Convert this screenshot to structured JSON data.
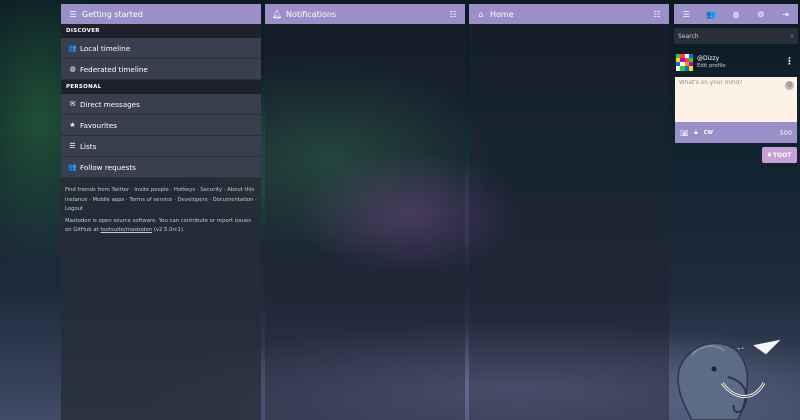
{
  "getting_started": {
    "title": "Getting started",
    "discover_label": "DISCOVER",
    "local_timeline": "Local timeline",
    "federated_timeline": "Federated timeline",
    "personal_label": "PERSONAL",
    "direct_messages": "Direct messages",
    "favourites": "Favourites",
    "lists": "Lists",
    "follow_requests": "Follow requests",
    "footer": {
      "find_friends": "Find friends from Twitter",
      "invite_people": "Invite people",
      "hotkeys": "Hotkeys",
      "security": "Security",
      "about": "About this instance",
      "mobile_apps": "Mobile apps",
      "terms": "Terms of service",
      "developers": "Developers",
      "documentation": "Documentation",
      "logout": "Logout",
      "oss_text": "Mastodon is open source software. You can contribute or report issues on GitHub at",
      "repo": "tootsuite/mastodon",
      "version": "(v2.5.0rc1)."
    }
  },
  "notifications": {
    "title": "Notifications"
  },
  "home": {
    "title": "Home"
  },
  "search": {
    "placeholder": "Search"
  },
  "profile": {
    "handle": "@Dizzy",
    "edit": "Edit profile"
  },
  "compose": {
    "placeholder": "What's on your mind?",
    "cw_label": "CW",
    "char_count": "500",
    "toot_label": "TOOT"
  },
  "colors": {
    "accent": "#9b8fc8",
    "toot_button": "#c8a0d8",
    "column_bg": "#282c37"
  }
}
